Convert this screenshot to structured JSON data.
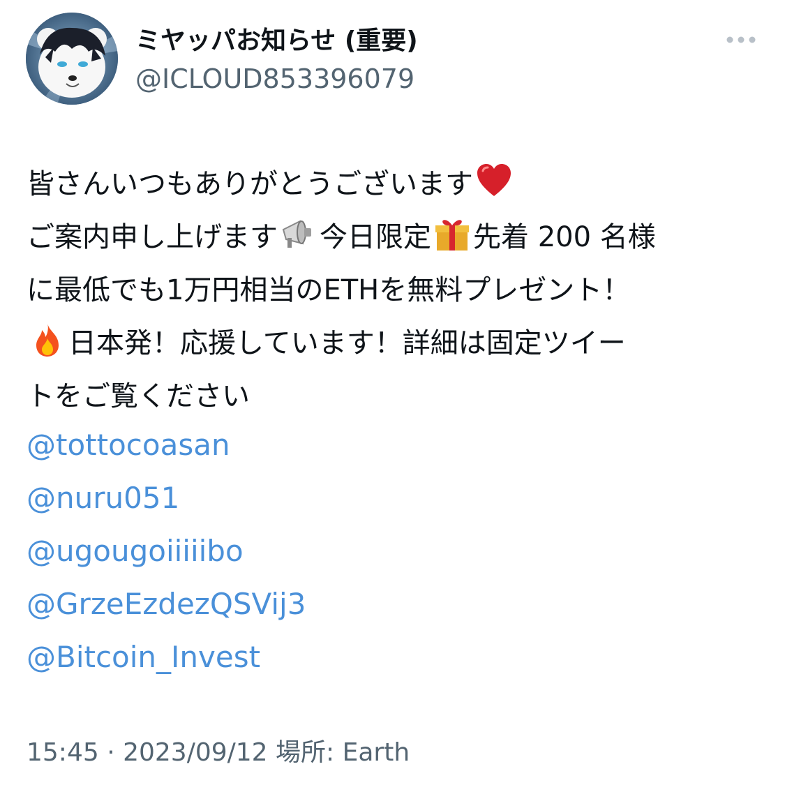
{
  "author": {
    "display_name": "ミヤッパお知らせ (重要)",
    "handle": "@ICLOUD853396079",
    "avatar_icon": "bear-avatar"
  },
  "more_icon": "more-horizontal-icon",
  "text": {
    "line1": "皆さんいつもありがとうございます",
    "line2_a": "ご案内申し上げます",
    "line2_b": "今日限定",
    "line2_c": "先着 200 名様",
    "line3": "に最低でも1万円相当のETHを無料プレゼント！",
    "line4": "日本発！応援しています！詳細は固定ツイー",
    "line5": "トをご覧ください"
  },
  "emojis": {
    "heart": "red-heart-icon",
    "megaphone": "megaphone-icon",
    "gift": "gift-icon",
    "fire": "fire-icon"
  },
  "mentions": [
    "@tottocoasan",
    "@nuru051",
    "@ugougoiiiiibo",
    "@GrzeEzdezQSVij3",
    "@Bitcoin_Invest"
  ],
  "meta": {
    "timestamp": "15:45 · 2023/09/12",
    "location": "場所: Earth"
  },
  "colors": {
    "link": "#4a90d9",
    "secondary": "#536471",
    "text": "#0f1419"
  }
}
